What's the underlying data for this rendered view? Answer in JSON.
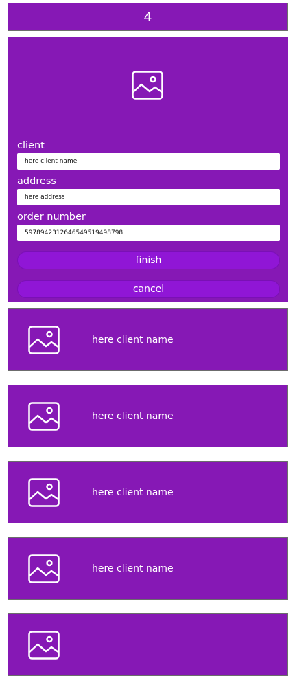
{
  "header": {
    "count": "4"
  },
  "form": {
    "image_icon": "image-icon",
    "client_label": "client",
    "client_placeholder": "here client name",
    "address_label": "address",
    "address_placeholder": "here address",
    "order_label": "order number",
    "order_value": "5978942312646549519498798",
    "finish_label": "finish",
    "cancel_label": "cancel"
  },
  "clients": [
    {
      "name": "here client name",
      "icon": "image-icon"
    },
    {
      "name": "here client name",
      "icon": "image-icon"
    },
    {
      "name": "here client name",
      "icon": "image-icon"
    },
    {
      "name": "here client name",
      "icon": "image-icon"
    },
    {
      "name": "",
      "icon": "image-icon"
    }
  ],
  "colors": {
    "primary": "#8618b5",
    "button": "#9016d6",
    "text": "#ffffff"
  }
}
